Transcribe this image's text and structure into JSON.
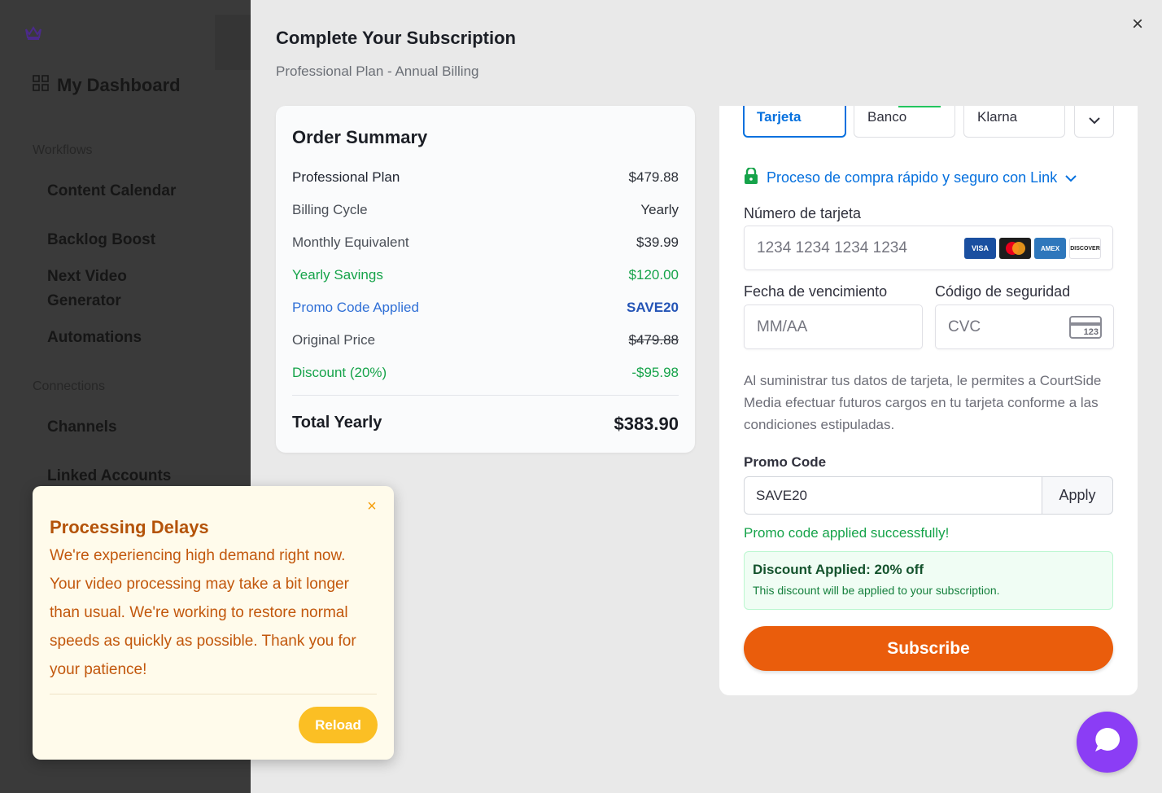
{
  "sidebar": {
    "dashboard_label": "My Dashboard",
    "sections": [
      {
        "label": "Workflows",
        "items": [
          "Content Calendar",
          "Backlog Boost",
          "Next Video Generator",
          "Automations"
        ]
      },
      {
        "label": "Connections",
        "items": [
          "Channels",
          "Linked Accounts"
        ]
      }
    ]
  },
  "modal": {
    "title": "Complete Your Subscription",
    "subtitle": "Professional Plan - Annual Billing",
    "close_icon": "close-icon"
  },
  "order_summary": {
    "heading": "Order Summary",
    "rows": [
      {
        "label": "Professional Plan",
        "value": "$479.88"
      },
      {
        "label": "Billing Cycle",
        "value": "Yearly"
      },
      {
        "label": "Monthly Equivalent",
        "value": "$39.99"
      },
      {
        "label": "Yearly Savings",
        "value": "$120.00"
      },
      {
        "label": "Promo Code Applied",
        "value": "SAVE20"
      },
      {
        "label": "Original Price",
        "value": "$479.88"
      },
      {
        "label": "Discount (20%)",
        "value": "-$95.98"
      }
    ],
    "total_label": "Total Yearly",
    "total_value": "$383.90"
  },
  "payment": {
    "tabs": [
      "Tarjeta",
      "Banco",
      "Klarna"
    ],
    "link_text": "Proceso de compra rápido y seguro con Link",
    "card_number_label": "Número de tarjeta",
    "card_number_placeholder": "1234 1234 1234 1234",
    "card_brands": [
      "VISA",
      "Mastercard",
      "AMEX",
      "DISCOVER"
    ],
    "expiry_label": "Fecha de vencimiento",
    "expiry_placeholder": "MM/AA",
    "cvc_label": "Código de seguridad",
    "cvc_placeholder": "CVC",
    "cvc_icon_text": "123",
    "disclaimer": "Al suministrar tus datos de tarjeta, le permites a CourtSide Media efectuar futuros cargos en tu tarjeta conforme a las condiciones estipuladas."
  },
  "promo": {
    "label": "Promo Code",
    "value": "SAVE20",
    "apply_label": "Apply",
    "success_text": "Promo code applied successfully!",
    "discount_title": "Discount Applied: 20% off",
    "discount_subtitle": "This discount will be applied to your subscription."
  },
  "subscribe_label": "Subscribe",
  "toast": {
    "title": "Processing Delays",
    "body": "We're experiencing high demand right now. Your video processing may take a bit longer than usual. We're working to restore normal speeds as quickly as possible. Thank you for your patience!",
    "reload_label": "Reload"
  },
  "colors": {
    "accent_blue": "#0570de",
    "subscribe_orange": "#ea5d0c",
    "success_green": "#16a34a",
    "warning_amber": "#fbbf24",
    "chat_purple": "#8b3df5"
  }
}
